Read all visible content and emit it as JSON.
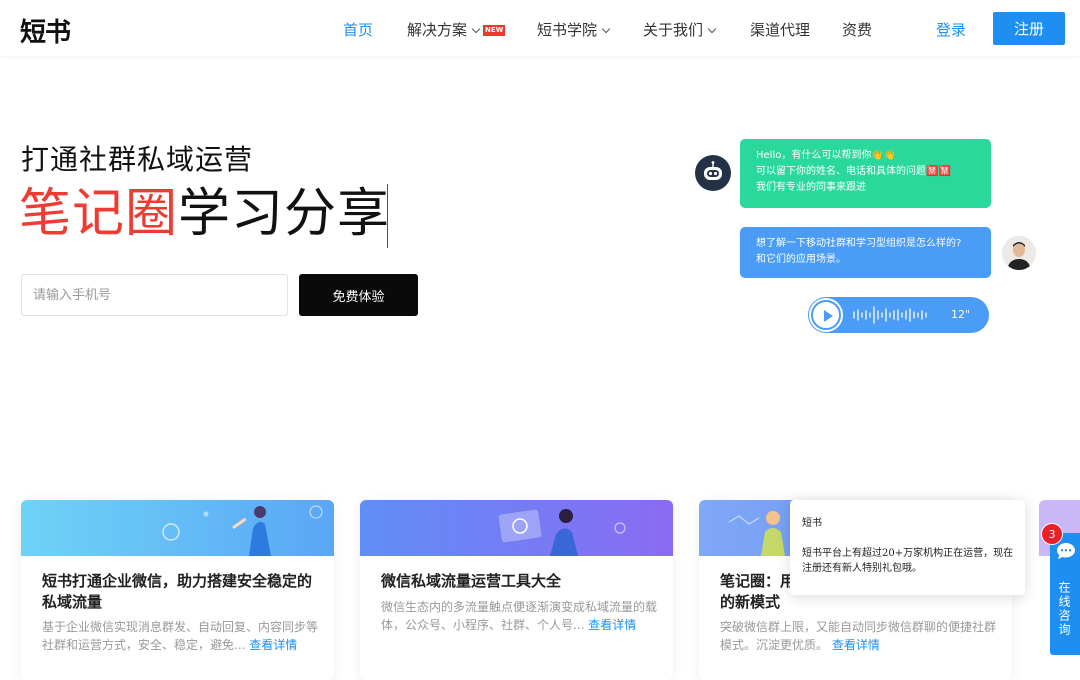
{
  "nav": {
    "logo": "短书",
    "items": [
      {
        "label": "首页",
        "active": true
      },
      {
        "label": "解决方案",
        "dropdown": true,
        "badge": "NEW"
      },
      {
        "label": "短书学院",
        "dropdown": true
      },
      {
        "label": "关于我们",
        "dropdown": true
      },
      {
        "label": "渠道代理"
      },
      {
        "label": "资费"
      }
    ],
    "login": "登录",
    "register": "注册"
  },
  "hero": {
    "subtitle": "打通社群私域运营",
    "title_red": "笔记圈",
    "title_dark": "学习分享",
    "input_placeholder": "请输入手机号",
    "button": "免费体验"
  },
  "chat": {
    "bot_lines": [
      "Hello，有什么可以帮到你👋👋",
      "可以留下你的姓名、电话和具体的问题🈲🈲",
      "我们有专业的同事来跟进"
    ],
    "user_lines": [
      "想了解一下移动社群和学习型组织是怎么样的?",
      "和它们的应用场景。"
    ],
    "voice_length": "12\""
  },
  "cards": [
    {
      "title": "短书打通企业微信，助力搭建安全稳定的私域流量",
      "desc": "基于企业微信实现消息群发、自动回复、内容同步等社群和运营方式，安全、稳定，避免...",
      "more": "查看详情"
    },
    {
      "title": "微信私域流量运营工具大全",
      "desc": "微信生态内的多流量触点便逐渐演变成私域流量的载体，公众号、小程序、社群、个人号...",
      "more": "查看详情"
    },
    {
      "title": "笔记圈：用",
      "title2": "的新模式",
      "desc": "突破微信群上限，又能自动同步微信群聊的便捷社群模式。沉淀更优质。",
      "more": "查看详情"
    }
  ],
  "popup": {
    "from": "短书",
    "message": "短书平台上有超过20+万家机构正在运营，现在注册还有新人特别礼包哦。"
  },
  "side": {
    "badge": "3",
    "label": "在线咨询"
  },
  "colors": {
    "accent": "#1e8ff0",
    "red": "#ef3b34",
    "green_bubble": "#2bd89c",
    "blue_bubble": "#4a9cf6"
  }
}
